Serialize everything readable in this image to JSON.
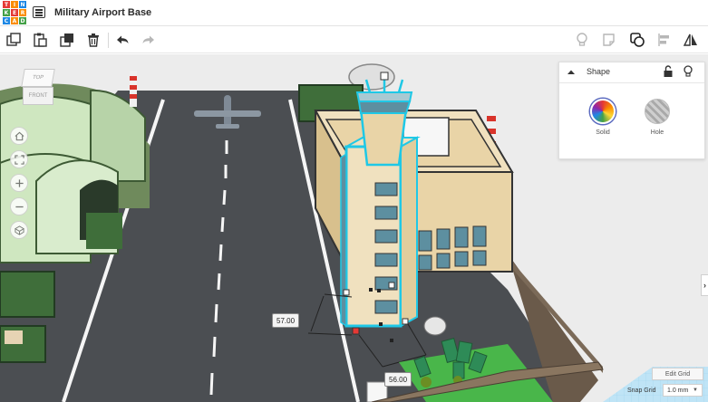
{
  "app": {
    "logo_letters": [
      "T",
      "I",
      "N",
      "K",
      "E",
      "R",
      "C",
      "A",
      "D"
    ],
    "logo_colors": [
      "#e53935",
      "#fb8c00",
      "#1e88e5",
      "#43a047",
      "#e53935",
      "#fb8c00",
      "#1e88e5",
      "#fb8c00",
      "#43a047"
    ],
    "design_title": "Military Airport Base"
  },
  "toolbar": {
    "left": [
      {
        "name": "copy-icon",
        "label": "Copy"
      },
      {
        "name": "paste-icon",
        "label": "Paste"
      },
      {
        "name": "duplicate-icon",
        "label": "Duplicate"
      },
      {
        "name": "delete-icon",
        "label": "Delete"
      },
      {
        "name": "undo-icon",
        "label": "Undo"
      },
      {
        "name": "redo-icon",
        "label": "Redo"
      }
    ],
    "right": [
      {
        "name": "bulb-icon",
        "label": "Show all"
      },
      {
        "name": "note-icon",
        "label": "Notes"
      },
      {
        "name": "group-icon",
        "label": "Group"
      },
      {
        "name": "align-icon",
        "label": "Align"
      },
      {
        "name": "mirror-icon",
        "label": "Mirror"
      }
    ]
  },
  "viewcube": {
    "top": "TOP",
    "front": "FRONT"
  },
  "nav_buttons": [
    "home-icon",
    "fit-icon",
    "zoom-in-icon",
    "zoom-out-icon",
    "perspective-icon"
  ],
  "shape_panel": {
    "title": "Shape",
    "solid_label": "Solid",
    "hole_label": "Hole"
  },
  "dimensions": {
    "height": "57.00",
    "width": "56.00"
  },
  "grid": {
    "edit_label": "Edit Grid",
    "snap_label": "Snap Grid",
    "snap_value": "1.0 mm"
  },
  "colors": {
    "accent": "#1e88e5",
    "selection": "#1fc8e6",
    "tarmac": "#4b4e52",
    "building": "#e9d4a7",
    "window": "#5d8fa0",
    "grass": "#2e8b57"
  }
}
